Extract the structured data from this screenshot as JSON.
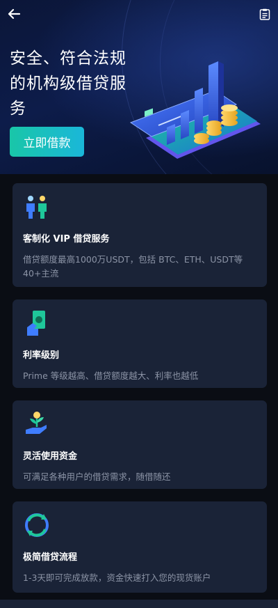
{
  "header": {
    "back_icon": "arrow-left-icon",
    "record_icon": "clipboard-list-icon"
  },
  "hero": {
    "title": "安全、符合法规的机构级借贷服务",
    "cta_label": "立即借款",
    "illustration": "bank-card-with-bar-chart-and-coins",
    "colors": {
      "cta_start": "#19c6a8",
      "cta_end": "#1ab7d9",
      "background": "#0d1c4a"
    }
  },
  "features": [
    {
      "icon": "two-people-icon",
      "title": "客制化 VIP 借贷服务",
      "desc": "借贷额度最高1000万USDT，包括 BTC、ETH、USDT等40+主流"
    },
    {
      "icon": "cash-in-hand-icon",
      "title": "利率级别",
      "desc": "Prime 等级越高、借贷额度越大、利率也越低"
    },
    {
      "icon": "plant-in-hand-icon",
      "title": "灵活使用资金",
      "desc": "可满足各种用户的借贷需求，随借随还"
    },
    {
      "icon": "circular-arrows-icon",
      "title": "极简借贷流程",
      "desc": "1-3天即可完成放款，资金快速打入您的现货账户"
    }
  ]
}
